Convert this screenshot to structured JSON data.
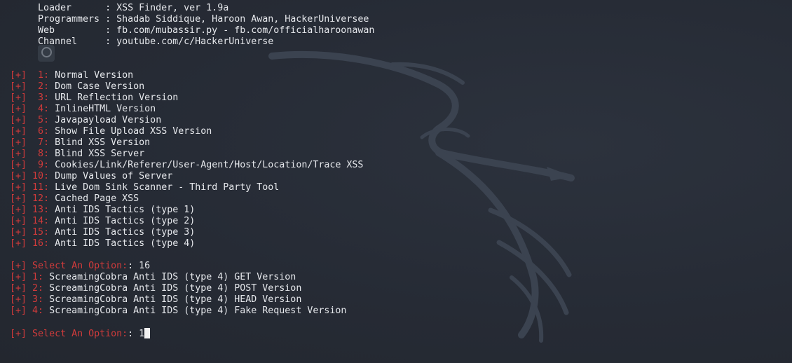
{
  "header": {
    "loader": {
      "key": "Loader      ",
      "sep": ": ",
      "value": "XSS Finder, ver 1.9a"
    },
    "programmers": {
      "key": "Programmers ",
      "sep": ": ",
      "value": "Shadab Siddique, Haroon Awan, HackerUniversee"
    },
    "web": {
      "key": "Web         ",
      "sep": ": ",
      "value": "fb.com/mubassir.py - fb.com/officialharoonawan"
    },
    "channel": {
      "key": "Channel     ",
      "sep": ": ",
      "value": "youtube.com/c/HackerUniverse"
    }
  },
  "prefix": "[+]",
  "menu": [
    {
      "num": " 1:",
      "label": "Normal Version"
    },
    {
      "num": " 2:",
      "label": "Dom Case Version"
    },
    {
      "num": " 3:",
      "label": "URL Reflection Version"
    },
    {
      "num": " 4:",
      "label": "InlineHTML Version"
    },
    {
      "num": " 5:",
      "label": "Javapayload Version"
    },
    {
      "num": " 6:",
      "label": "Show File Upload XSS Version"
    },
    {
      "num": " 7:",
      "label": "Blind XSS Version"
    },
    {
      "num": " 8:",
      "label": "Blind XSS Server"
    },
    {
      "num": " 9:",
      "label": "Cookies/Link/Referer/User-Agent/Host/Location/Trace XSS"
    },
    {
      "num": "10:",
      "label": "Dump Values of Server"
    },
    {
      "num": "11:",
      "label": "Live Dom Sink Scanner - Third Party Tool"
    },
    {
      "num": "12:",
      "label": "Cached Page XSS"
    },
    {
      "num": "13:",
      "label": "Anti IDS Tactics (type 1)"
    },
    {
      "num": "14:",
      "label": "Anti IDS Tactics (type 2)"
    },
    {
      "num": "15:",
      "label": "Anti IDS Tactics (type 3)"
    },
    {
      "num": "16:",
      "label": "Anti IDS Tactics (type 4)"
    }
  ],
  "prompt1": {
    "label": "Select An Option:",
    "sep": ": ",
    "value": "16"
  },
  "submenu": [
    {
      "num": "1:",
      "label": "ScreamingCobra Anti IDS (type 4) GET Version"
    },
    {
      "num": "2:",
      "label": "ScreamingCobra Anti IDS (type 4) POST Version"
    },
    {
      "num": "3:",
      "label": "ScreamingCobra Anti IDS (type 4) HEAD Version"
    },
    {
      "num": "4:",
      "label": "ScreamingCobra Anti IDS (type 4) Fake Request Version"
    }
  ],
  "prompt2": {
    "label": "Select An Option:",
    "sep": ": ",
    "value": "1"
  },
  "colors": {
    "background": "#262b35",
    "accent_red": "#d03b3b",
    "text": "#e6e8ec"
  },
  "icons": [
    "kali-dragon-watermark-icon",
    "app-badge-icon",
    "cursor-icon"
  ]
}
